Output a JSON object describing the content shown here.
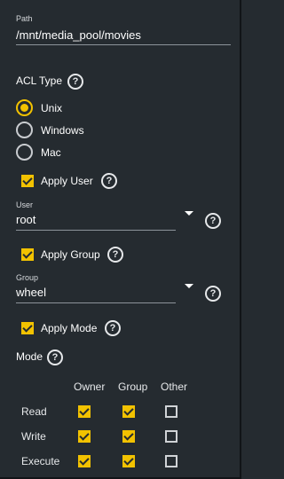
{
  "path": {
    "label": "Path",
    "value": "/mnt/media_pool/movies"
  },
  "acl_type": {
    "label": "ACL Type",
    "help_icon": "help-circle-icon",
    "options": [
      {
        "label": "Unix",
        "selected": true
      },
      {
        "label": "Windows",
        "selected": false
      },
      {
        "label": "Mac",
        "selected": false
      }
    ]
  },
  "apply_user": {
    "label": "Apply User",
    "checked": true
  },
  "user": {
    "label": "User",
    "value": "root"
  },
  "apply_group": {
    "label": "Apply Group",
    "checked": true
  },
  "group": {
    "label": "Group",
    "value": "wheel"
  },
  "apply_mode": {
    "label": "Apply Mode",
    "checked": true
  },
  "mode": {
    "label": "Mode",
    "columns": [
      "Owner",
      "Group",
      "Other"
    ],
    "rows": [
      {
        "label": "Read",
        "values": [
          true,
          true,
          false
        ]
      },
      {
        "label": "Write",
        "values": [
          true,
          true,
          false
        ]
      },
      {
        "label": "Execute",
        "values": [
          true,
          true,
          false
        ]
      }
    ]
  },
  "colors": {
    "accent": "#f2c200",
    "background": "#252b30"
  }
}
